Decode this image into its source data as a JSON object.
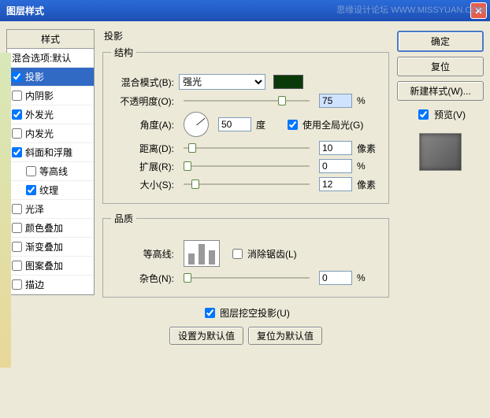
{
  "watermark": "思缘设计论坛 WWW.MISSYUAN.COM",
  "windowTitle": "图层样式",
  "left": {
    "header": "样式",
    "blendOptions": "混合选项:默认",
    "items": [
      {
        "label": "投影",
        "checked": true,
        "selected": true
      },
      {
        "label": "内阴影",
        "checked": false
      },
      {
        "label": "外发光",
        "checked": true
      },
      {
        "label": "内发光",
        "checked": false
      },
      {
        "label": "斜面和浮雕",
        "checked": true
      },
      {
        "label": "等高线",
        "checked": false,
        "deep": true
      },
      {
        "label": "纹理",
        "checked": true,
        "deep": true
      },
      {
        "label": "光泽",
        "checked": false
      },
      {
        "label": "颜色叠加",
        "checked": false
      },
      {
        "label": "渐变叠加",
        "checked": false
      },
      {
        "label": "图案叠加",
        "checked": false
      },
      {
        "label": "描边",
        "checked": false
      }
    ]
  },
  "mid": {
    "panelTitle": "投影",
    "structure": {
      "legend": "结构",
      "blendModeLabel": "混合模式(B):",
      "blendModeValue": "强光",
      "opacityLabel": "不透明度(O):",
      "opacityValue": "75",
      "opacityUnit": "%",
      "angleLabel": "角度(A):",
      "angleValue": "50",
      "angleUnit": "度",
      "useGlobalLight": "使用全局光(G)",
      "distanceLabel": "距离(D):",
      "distanceValue": "10",
      "distanceUnit": "像素",
      "spreadLabel": "扩展(R):",
      "spreadValue": "0",
      "spreadUnit": "%",
      "sizeLabel": "大小(S):",
      "sizeValue": "12",
      "sizeUnit": "像素"
    },
    "quality": {
      "legend": "品质",
      "contourLabel": "等高线:",
      "antialias": "消除锯齿(L)",
      "noiseLabel": "杂色(N):",
      "noiseValue": "0",
      "noiseUnit": "%"
    },
    "knockout": "图层挖空投影(U)",
    "setDefault": "设置为默认值",
    "resetDefault": "复位为默认值"
  },
  "right": {
    "ok": "确定",
    "cancel": "复位",
    "newStyle": "新建样式(W)...",
    "preview": "预览(V)"
  }
}
